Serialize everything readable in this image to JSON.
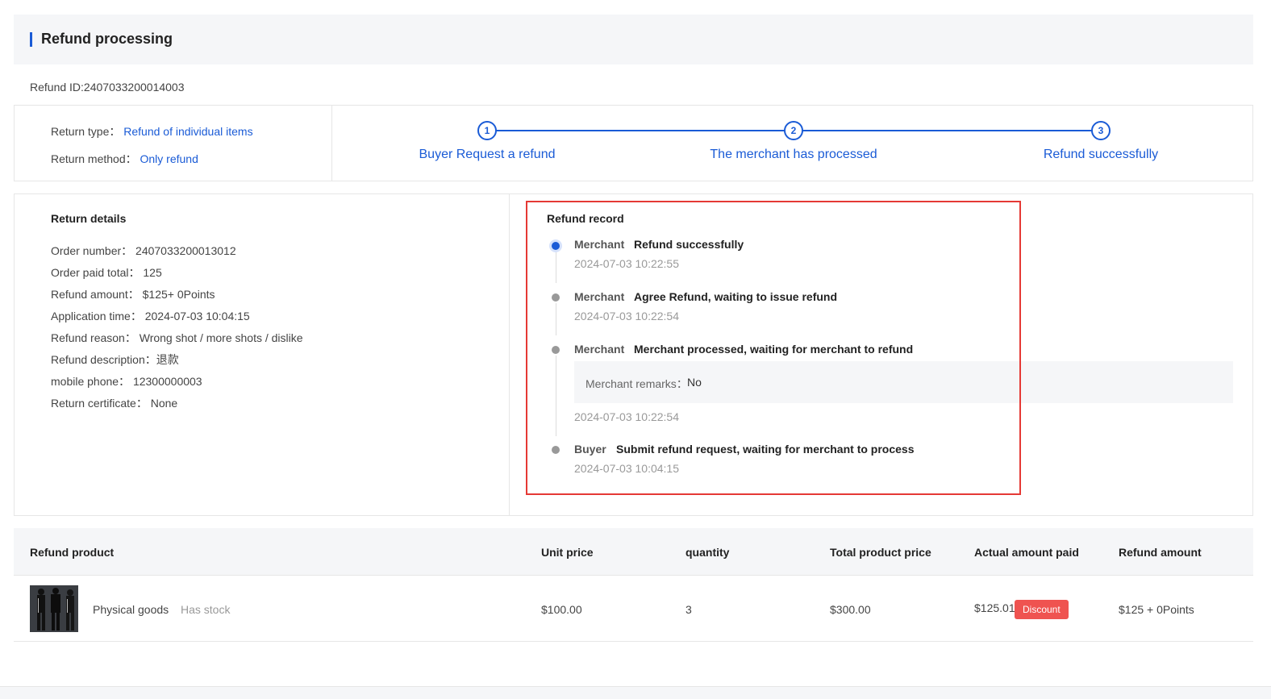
{
  "header": {
    "title": "Refund processing"
  },
  "refund_id": "Refund ID:2407033200014003",
  "info": {
    "return_type_label": "Return type：",
    "return_type_value": "Refund of individual items",
    "return_method_label": "Return method：",
    "return_method_value": "Only refund"
  },
  "steps": [
    {
      "number": "1",
      "label": "Buyer Request a refund"
    },
    {
      "number": "2",
      "label": "The merchant has processed"
    },
    {
      "number": "3",
      "label": "Refund successfully"
    }
  ],
  "return_details": {
    "title": "Return details",
    "lines": [
      "Order number： 2407033200013012",
      "Order paid total： 125",
      "Refund amount： $125+ 0Points",
      "Application time： 2024-07-03 10:04:15",
      "Refund reason： Wrong shot / more shots / dislike",
      "Refund description：退款",
      "mobile phone： 12300000003",
      "Return certificate： None"
    ]
  },
  "refund_record": {
    "title": "Refund record",
    "entries": [
      {
        "actor": "Merchant",
        "action": "Refund successfully",
        "time": "2024-07-03 10:22:55"
      },
      {
        "actor": "Merchant",
        "action": "Agree Refund, waiting to issue refund",
        "time": "2024-07-03 10:22:54"
      },
      {
        "actor": "Merchant",
        "action": "Merchant processed, waiting for merchant to refund",
        "time": "2024-07-03 10:22:54",
        "remarks_label": "Merchant remarks：",
        "remarks_value": "No"
      },
      {
        "actor": "Buyer",
        "action": "Submit refund request, waiting for merchant to process",
        "time": "2024-07-03 10:04:15"
      }
    ]
  },
  "table": {
    "headers": [
      "Refund product",
      "Unit price",
      "quantity",
      "Total product price",
      "Actual amount paid",
      "Refund amount"
    ],
    "row": {
      "product_name": "Physical goods",
      "stock_status": "Has stock",
      "unit_price": "$100.00",
      "quantity": "3",
      "total_price": "$300.00",
      "actual_paid": "$125.01",
      "discount_badge": "Discount",
      "refund_amount": "$125 + 0Points"
    }
  },
  "colors": {
    "accent": "#1a5bd6",
    "highlight": "#e53935",
    "badge": "#ef5350"
  }
}
